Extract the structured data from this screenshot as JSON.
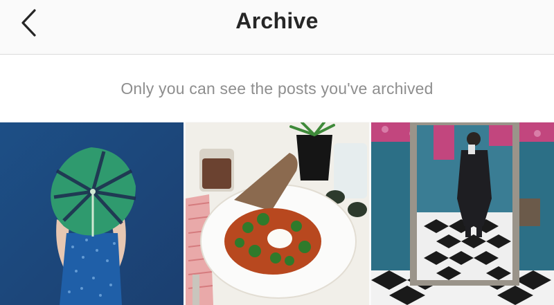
{
  "header": {
    "title": "Archive",
    "back_icon": "chevron-left-icon"
  },
  "notice": {
    "text": "Only you can see the posts you've archived"
  },
  "posts": [
    {
      "subject": "monstera-leaf-portrait"
    },
    {
      "subject": "shakshuka-breakfast"
    },
    {
      "subject": "mirror-selfie"
    }
  ],
  "colors": {
    "title": "#262626",
    "secondary_text": "#8e8e8e",
    "divider": "#dbdbdb"
  }
}
